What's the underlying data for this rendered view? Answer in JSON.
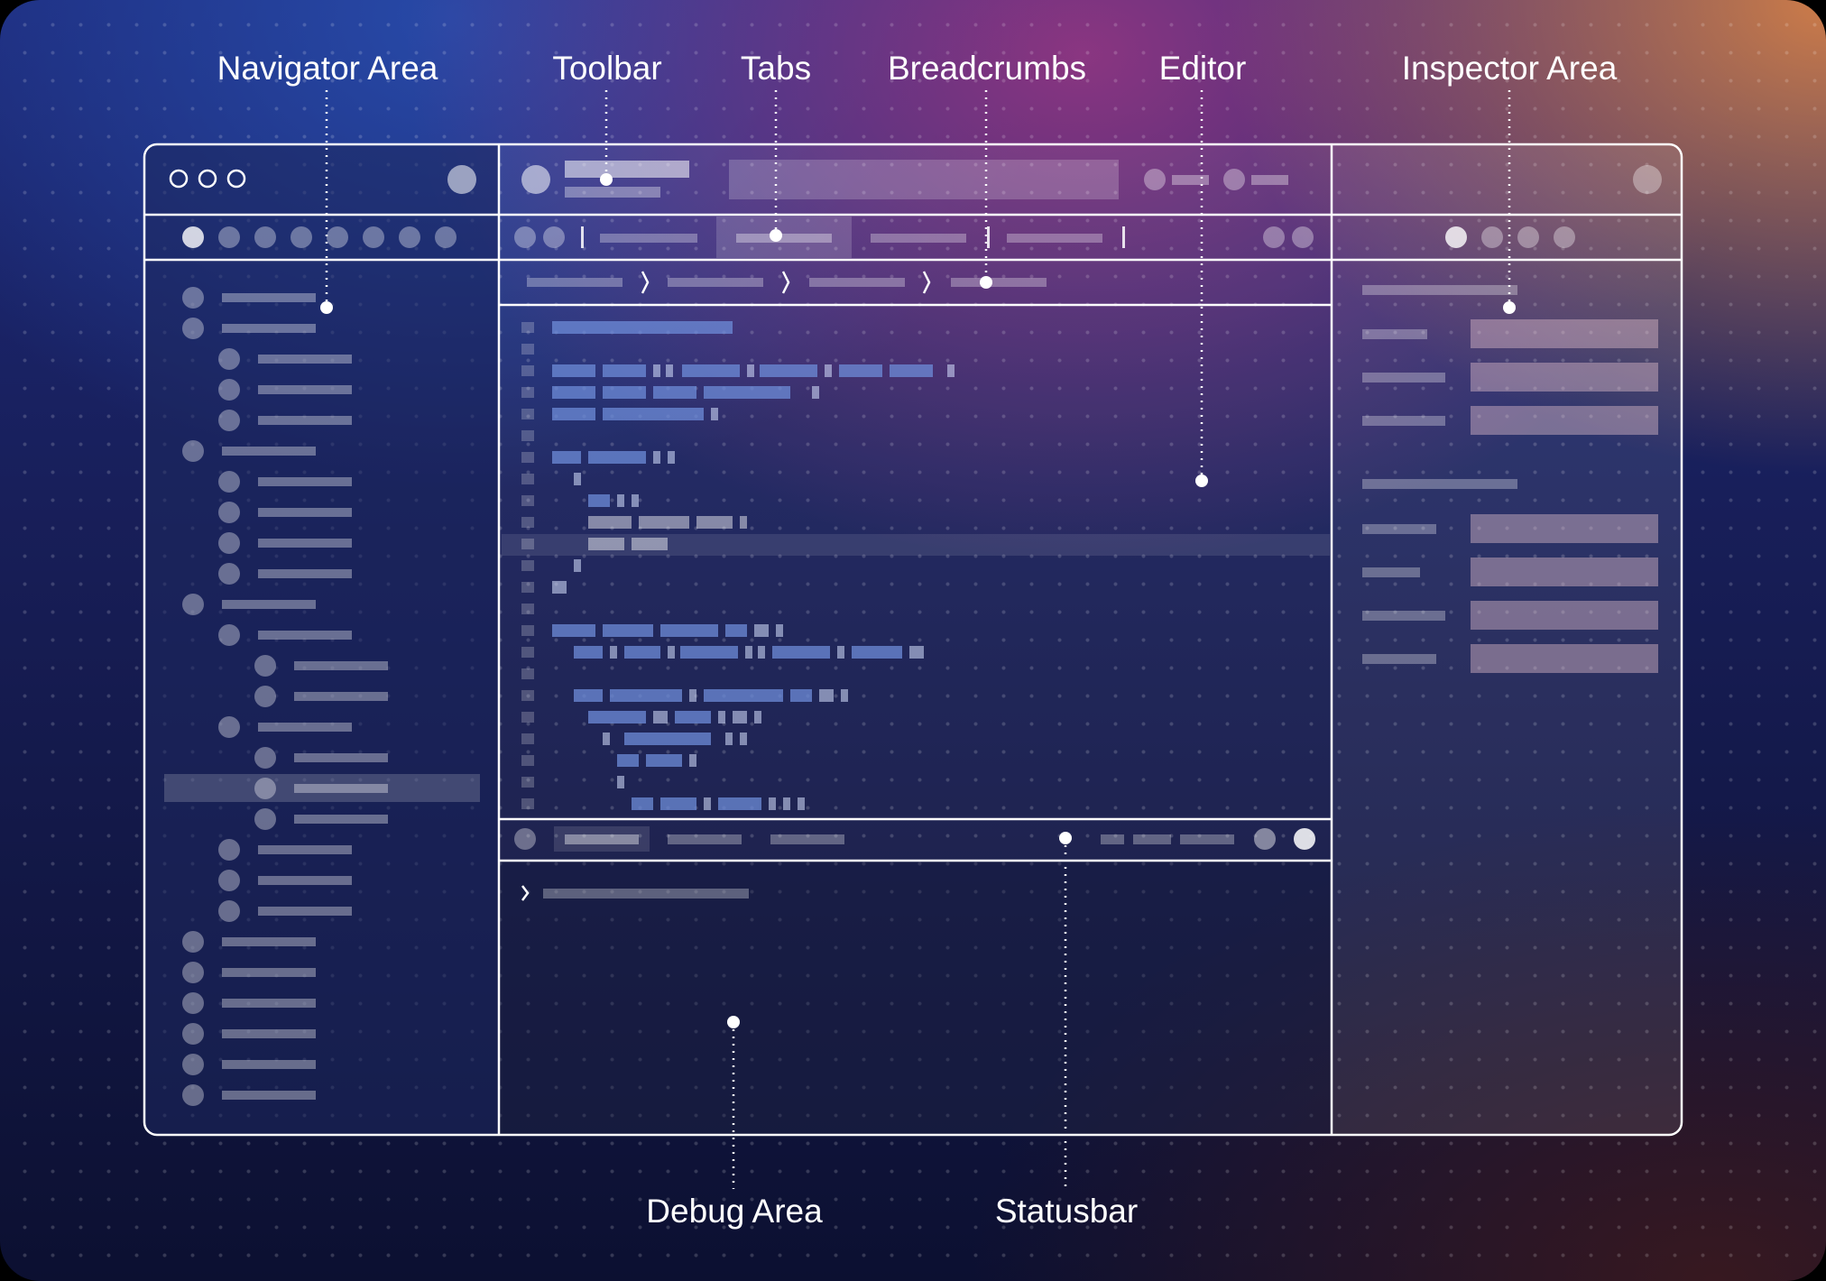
{
  "callouts": {
    "navigator": "Navigator Area",
    "toolbar": "Toolbar",
    "tabs": "Tabs",
    "breadcrumbs": "Breadcrumbs",
    "editor": "Editor",
    "inspector": "Inspector Area",
    "debug": "Debug Area",
    "statusbar": "Statusbar"
  },
  "colors": {
    "window_border": "#ffffff",
    "placeholder": "#ffffff",
    "code_token": "#6e8cd8",
    "inspector_field": "#e6c3cf"
  },
  "icons": {
    "window_controls": "traffic-light-circles",
    "breadcrumb_separator": "chevron-right-icon",
    "debug_prompt": "chevron-right-icon"
  }
}
